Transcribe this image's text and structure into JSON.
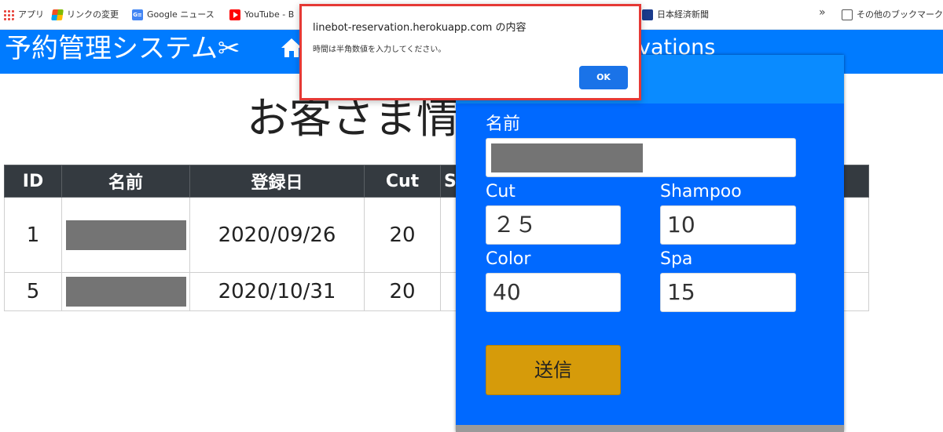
{
  "bookmarks": {
    "items": [
      {
        "label": "アプリ",
        "icon": "apps-grid-icon"
      },
      {
        "label": "リンクの変更",
        "icon": "windows-logo-icon"
      },
      {
        "label": "Google ニュース",
        "icon": "google-news-icon"
      },
      {
        "label": "YouTube - B",
        "icon": "youtube-icon"
      },
      {
        "label": "日本経済新聞",
        "icon": "nikkei-icon"
      }
    ],
    "more": "»",
    "other": "その他のブックマーク"
  },
  "header": {
    "brand": "予約管理システム✂",
    "nav_link": "vations"
  },
  "page": {
    "title": "お客さま情"
  },
  "table": {
    "columns": [
      "ID",
      "名前",
      "登録日",
      "Cut",
      "S"
    ],
    "rows": [
      {
        "id": "1",
        "date": "2020/09/26",
        "cut": "20"
      },
      {
        "id": "5",
        "date": "2020/10/31",
        "cut": "20"
      }
    ]
  },
  "form": {
    "name_label": "名前",
    "cut_label": "Cut",
    "cut_value": "２５",
    "shampoo_label": "Shampoo",
    "shampoo_value": "10",
    "color_label": "Color",
    "color_value": "40",
    "spa_label": "Spa",
    "spa_value": "15",
    "submit_label": "送信"
  },
  "alert": {
    "title": "linebot-reservation.herokuapp.com の内容",
    "message": "時間は半角数値を入力してください。",
    "ok_label": "OK"
  },
  "colors": {
    "header_blue": "#007bff",
    "modal_blue": "#0069ff",
    "submit_gold": "#d69b0a",
    "alert_border": "#e53935",
    "ok_blue": "#1a73e8",
    "table_head": "#343a40"
  }
}
